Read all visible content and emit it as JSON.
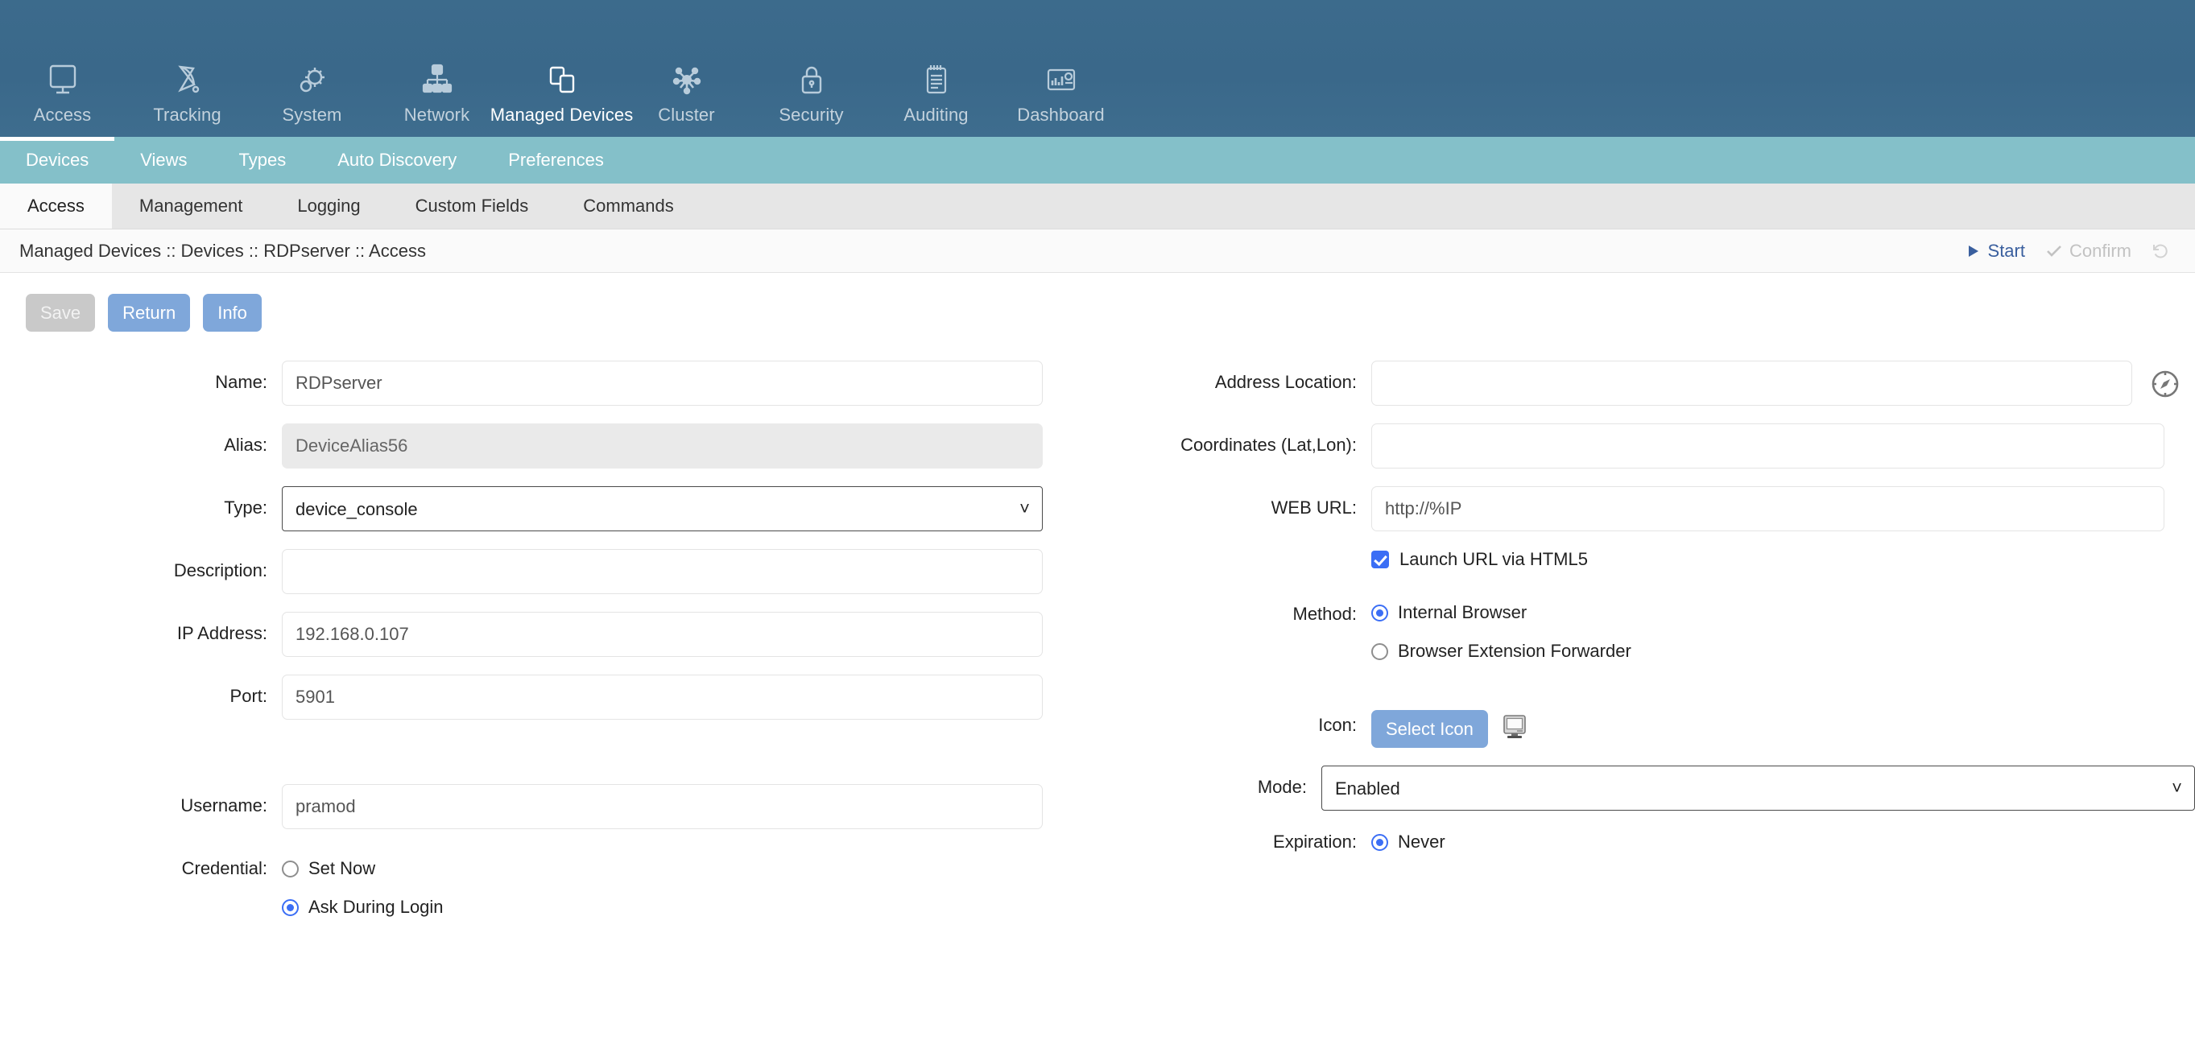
{
  "topnav": {
    "items": [
      {
        "label": "Access",
        "icon": "monitor-icon",
        "active": false
      },
      {
        "label": "Tracking",
        "icon": "satellite-dish-icon",
        "active": false
      },
      {
        "label": "System",
        "icon": "gear-icon",
        "active": false
      },
      {
        "label": "Network",
        "icon": "network-tree-icon",
        "active": false
      },
      {
        "label": "Managed Devices",
        "icon": "devices-stack-icon",
        "active": true
      },
      {
        "label": "Cluster",
        "icon": "cluster-nodes-icon",
        "active": false
      },
      {
        "label": "Security",
        "icon": "lock-icon",
        "active": false
      },
      {
        "label": "Auditing",
        "icon": "notepad-icon",
        "active": false
      },
      {
        "label": "Dashboard",
        "icon": "chart-panel-icon",
        "active": false
      }
    ]
  },
  "subnav": {
    "items": [
      {
        "label": "Devices",
        "active": true
      },
      {
        "label": "Views",
        "active": false
      },
      {
        "label": "Types",
        "active": false
      },
      {
        "label": "Auto Discovery",
        "active": false
      },
      {
        "label": "Preferences",
        "active": false
      }
    ]
  },
  "tabs": {
    "items": [
      {
        "label": "Access",
        "active": true
      },
      {
        "label": "Management",
        "active": false
      },
      {
        "label": "Logging",
        "active": false
      },
      {
        "label": "Custom Fields",
        "active": false
      },
      {
        "label": "Commands",
        "active": false
      }
    ]
  },
  "breadcrumb": {
    "text": "Managed Devices :: Devices :: RDPserver :: Access",
    "actions": [
      {
        "label": "Start",
        "icon": "play-icon",
        "state": "enabled"
      },
      {
        "label": "Confirm",
        "icon": "check-icon",
        "state": "disabled"
      },
      {
        "label": "",
        "icon": "revert-icon",
        "state": "disabled"
      }
    ]
  },
  "toolbar": {
    "save_label": "Save",
    "return_label": "Return",
    "info_label": "Info"
  },
  "form": {
    "left": {
      "name_label": "Name:",
      "name_value": "RDPserver",
      "alias_label": "Alias:",
      "alias_value": "DeviceAlias56",
      "type_label": "Type:",
      "type_value": "device_console",
      "type_options": [
        "device_console"
      ],
      "description_label": "Description:",
      "description_value": "",
      "ip_label": "IP Address:",
      "ip_value": "192.168.0.107",
      "port_label": "Port:",
      "port_value": "5901",
      "username_label": "Username:",
      "username_value": "pramod",
      "credential_label": "Credential:",
      "credential_options": [
        {
          "label": "Set Now",
          "selected": false
        },
        {
          "label": "Ask During Login",
          "selected": true
        }
      ]
    },
    "right": {
      "address_location_label": "Address Location:",
      "address_location_value": "",
      "locate_icon": "compass-icon",
      "coordinates_label": "Coordinates (Lat,Lon):",
      "coordinates_value": "",
      "web_url_label": "WEB URL:",
      "web_url_value": "http://%IP",
      "launch_html5_label": "Launch URL via HTML5",
      "launch_html5_checked": true,
      "method_label": "Method:",
      "method_options": [
        {
          "label": "Internal Browser",
          "selected": true
        },
        {
          "label": "Browser Extension Forwarder",
          "selected": false
        }
      ],
      "icon_label": "Icon:",
      "select_icon_label": "Select Icon",
      "icon_preview": "monitor-icon",
      "mode_label": "Mode:",
      "mode_value": "Enabled",
      "mode_options": [
        "Enabled"
      ],
      "expiration_label": "Expiration:",
      "expiration_options": [
        {
          "label": "Never",
          "selected": true
        }
      ]
    }
  },
  "colors": {
    "header_blue": "#3a688a",
    "teal": "#84c0c9",
    "accent_blue": "#7fa7da",
    "radio_blue": "#3b6ef5",
    "tabbar_gray": "#e6e6e6"
  }
}
